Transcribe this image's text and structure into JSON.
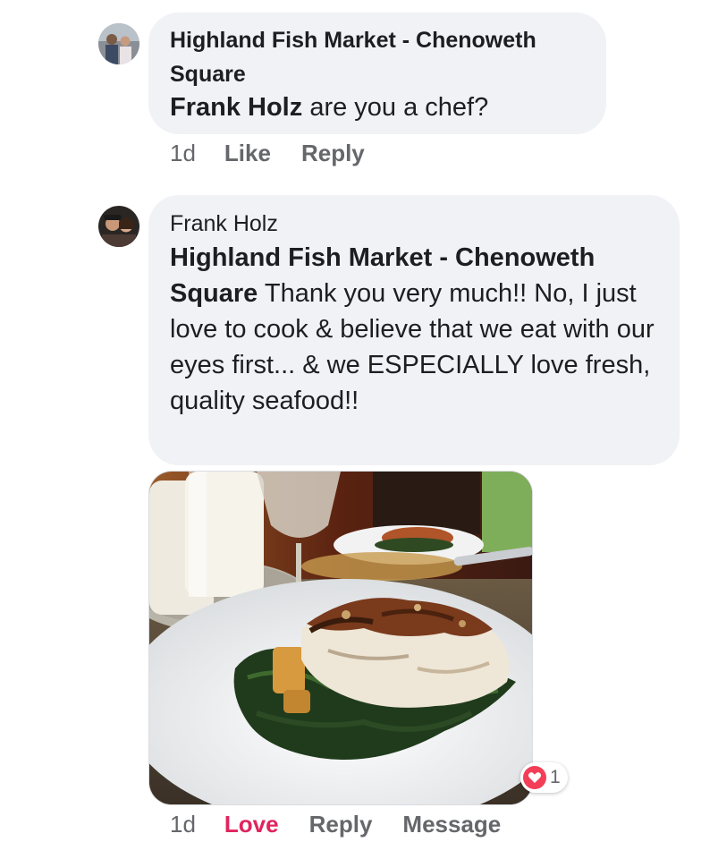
{
  "comments": [
    {
      "author": "Highland Fish Market - Chenoweth Square",
      "mention": "Frank Holz",
      "text": "are you a chef?",
      "time": "1d",
      "actions": [
        "Like",
        "Reply"
      ]
    },
    {
      "author": "Frank Holz",
      "mention": "Highland Fish Market - Chenoweth Square",
      "text": "Thank you very much!!  No, I just love to cook & believe that we eat with our eyes first... & we ESPECIALLY love fresh, quality seafood!!",
      "time": "1d",
      "actions": [
        "Love",
        "Reply",
        "Message"
      ],
      "reaction_count": "1",
      "reaction_icon": "heart-icon"
    }
  ],
  "colors": {
    "bubble": "#f0f2f5",
    "text": "#1c1e21",
    "meta": "#65676b",
    "love": "#e0245e",
    "heart_reaction": "#f33e58"
  },
  "icons": {
    "avatar1": "avatar-couple",
    "avatar2": "avatar-couple",
    "photo": "food-photo-fish-on-greens"
  }
}
